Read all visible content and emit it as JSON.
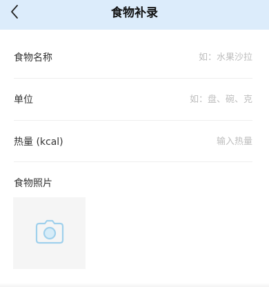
{
  "header": {
    "title": "食物补录",
    "back_icon": "chevron-left-icon"
  },
  "form": {
    "fields": [
      {
        "label": "食物名称",
        "placeholder": "如：水果沙拉",
        "value": ""
      },
      {
        "label": "单位",
        "placeholder": "如：盘、碗、克",
        "value": ""
      },
      {
        "label": "热量 (kcal)",
        "placeholder": "输入热量",
        "value": ""
      }
    ],
    "photo": {
      "label": "食物照片",
      "icon": "camera-icon"
    }
  },
  "colors": {
    "header_bg": "#dcecfb",
    "camera_icon": "#9fd0ec",
    "photo_bg": "#f5f5f5",
    "placeholder": "#bdbdbd"
  }
}
